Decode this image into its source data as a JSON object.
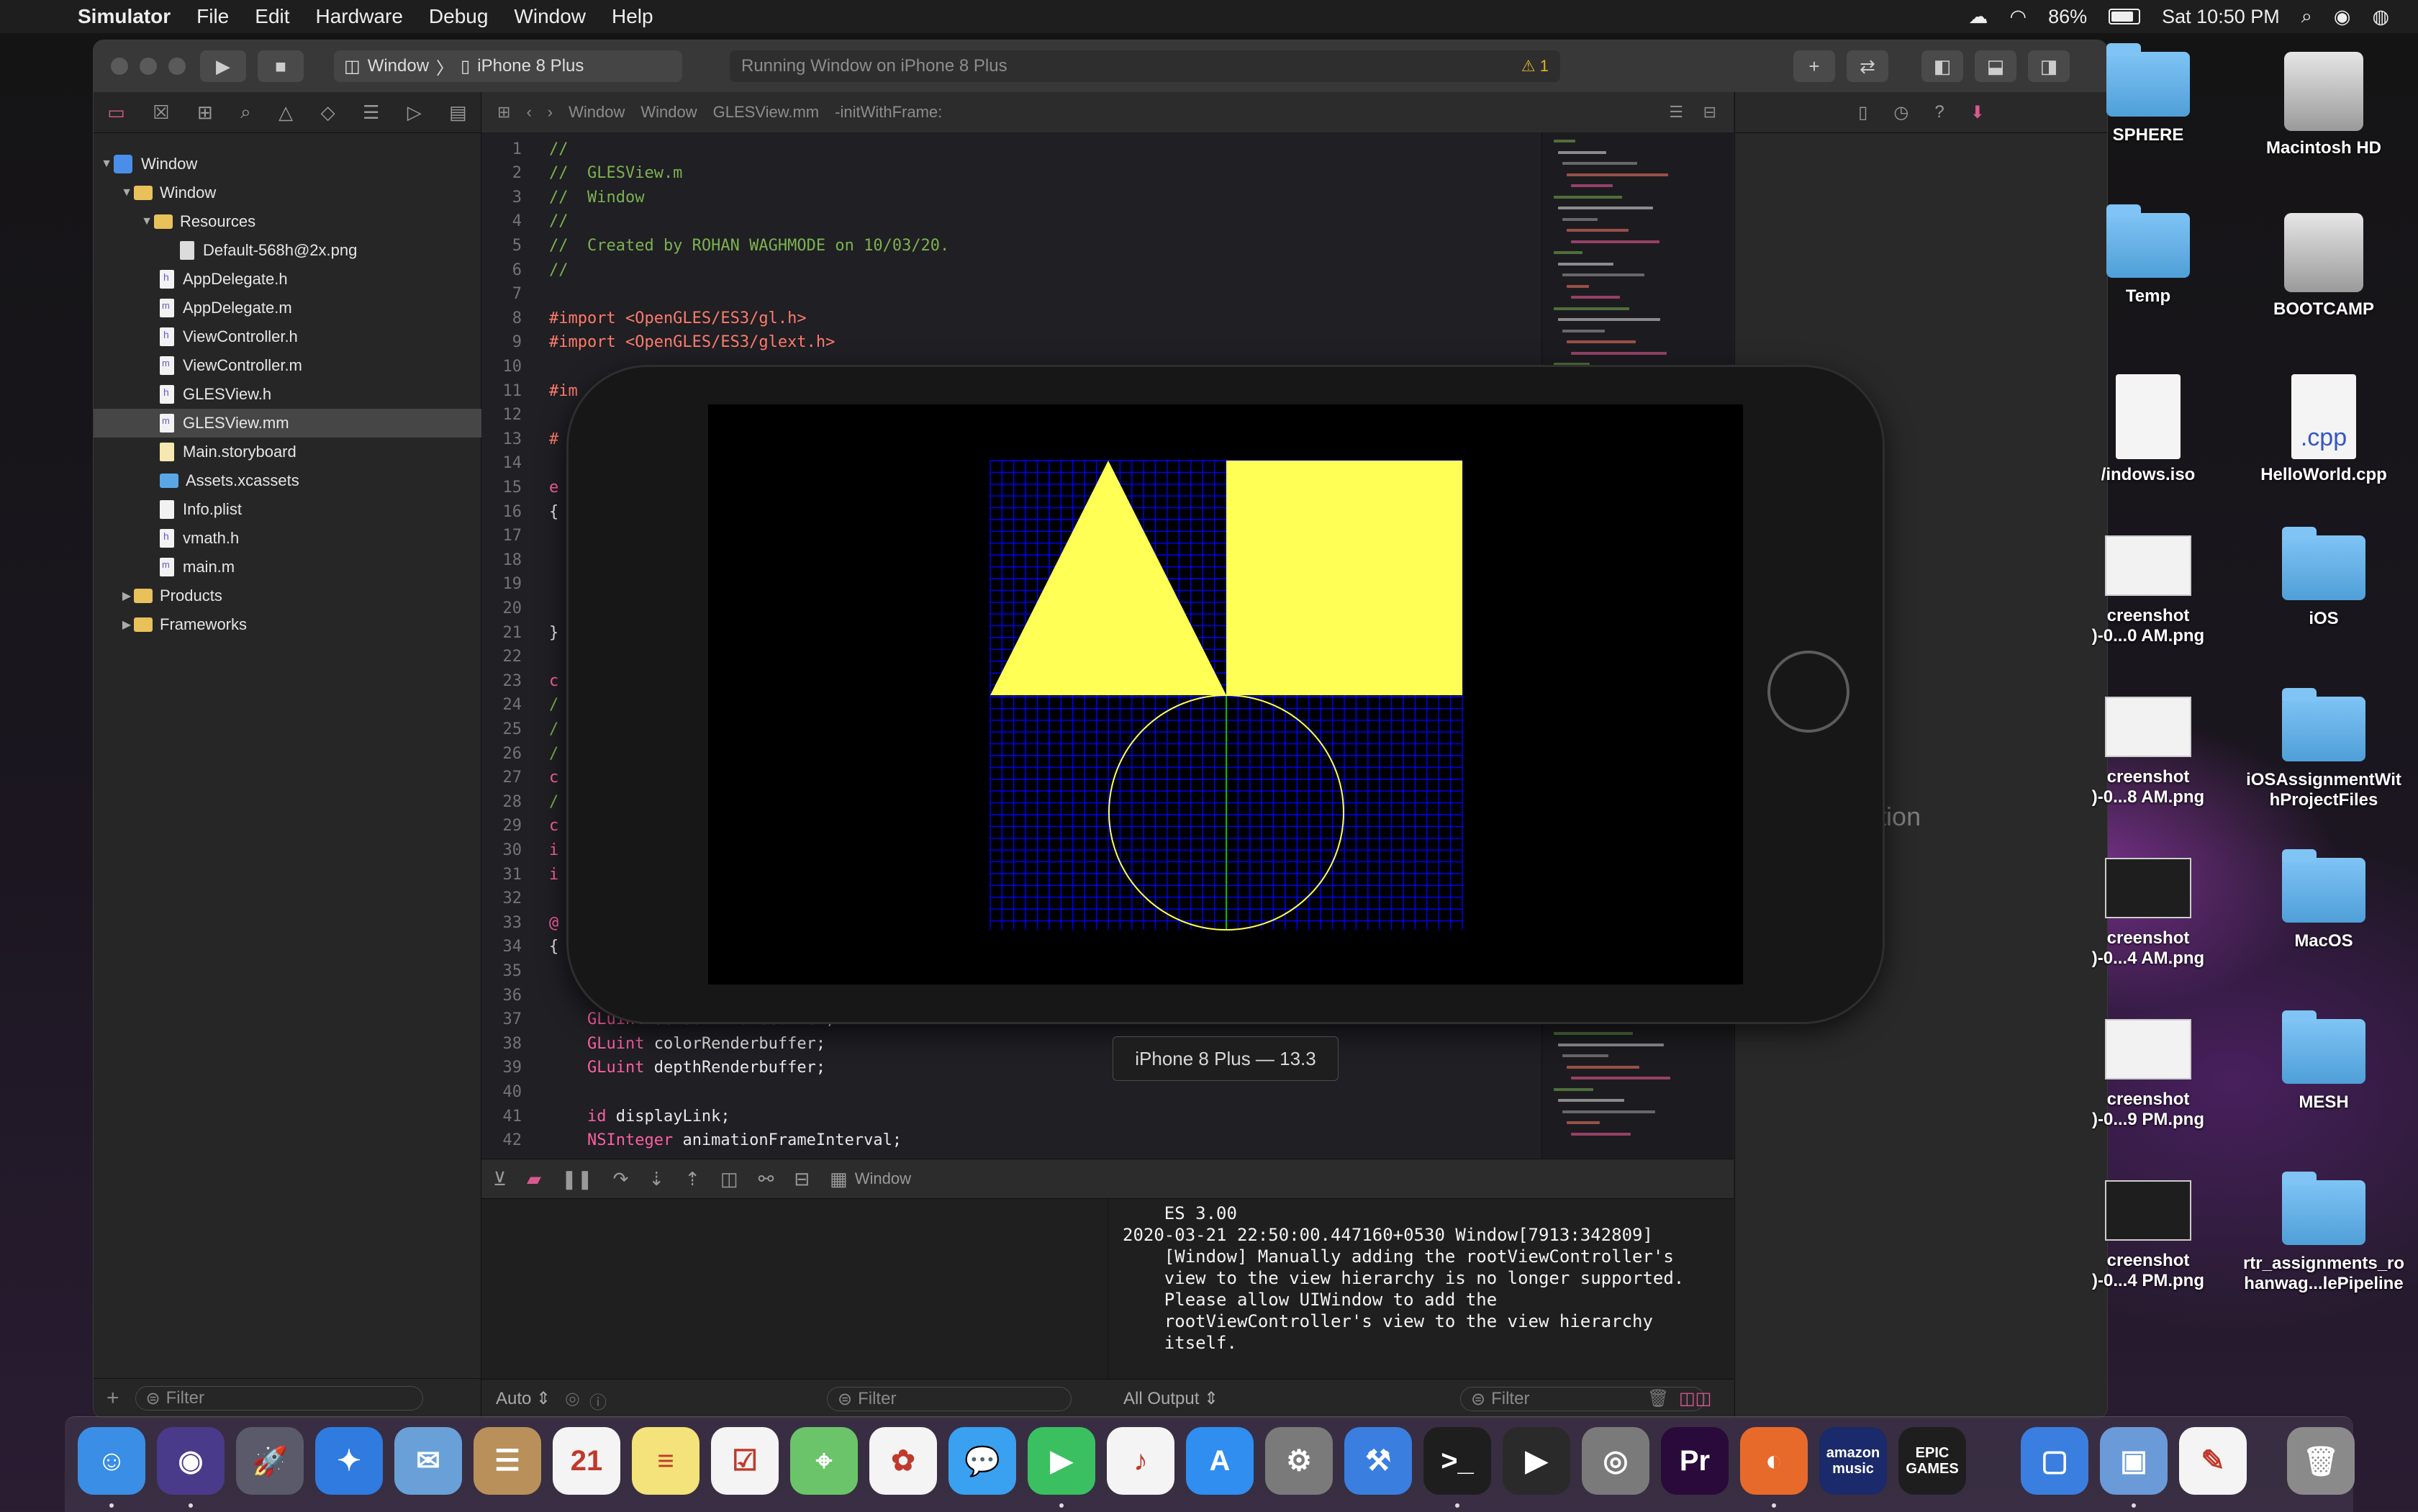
{
  "menubar": {
    "app_name": "Simulator",
    "items": [
      "File",
      "Edit",
      "Hardware",
      "Debug",
      "Window",
      "Help"
    ],
    "battery": "86%",
    "clock": "Sat 10:50 PM"
  },
  "toolbar": {
    "scheme_target": "Window",
    "scheme_device": "iPhone 8 Plus",
    "activity_text": "Running Window on iPhone 8 Plus",
    "warning_count": "1"
  },
  "navigator": {
    "items": [
      {
        "label": "Window"
      },
      {
        "label": "Window"
      },
      {
        "label": "Resources"
      },
      {
        "label": "Default-568h@2x.png"
      },
      {
        "label": "AppDelegate.h"
      },
      {
        "label": "AppDelegate.m"
      },
      {
        "label": "ViewController.h"
      },
      {
        "label": "ViewController.m"
      },
      {
        "label": "GLESView.h"
      },
      {
        "label": "GLESView.mm"
      },
      {
        "label": "Main.storyboard"
      },
      {
        "label": "Assets.xcassets"
      },
      {
        "label": "Info.plist"
      },
      {
        "label": "vmath.h"
      },
      {
        "label": "main.m"
      },
      {
        "label": "Products"
      },
      {
        "label": "Frameworks"
      }
    ],
    "filter_placeholder": "Filter"
  },
  "jumpbar": {
    "crumbs": [
      "Window",
      "Window",
      "GLESView.mm",
      "-initWithFrame:"
    ]
  },
  "editor": {
    "lines": [
      {
        "n": "1",
        "t": "//"
      },
      {
        "n": "2",
        "t": "//  GLESView.m"
      },
      {
        "n": "3",
        "t": "//  Window"
      },
      {
        "n": "4",
        "t": "//"
      },
      {
        "n": "5",
        "t": "//  Created by ROHAN WAGHMODE on 10/03/20."
      },
      {
        "n": "6",
        "t": "//"
      },
      {
        "n": "7",
        "t": ""
      },
      {
        "n": "8",
        "t": "#import <OpenGLES/ES3/gl.h>"
      },
      {
        "n": "9",
        "t": "#import <OpenGLES/ES3/glext.h>"
      },
      {
        "n": "10",
        "t": ""
      },
      {
        "n": "11",
        "t": "#im"
      },
      {
        "n": "12",
        "t": ""
      },
      {
        "n": "13",
        "t": "#"
      },
      {
        "n": "14",
        "t": ""
      },
      {
        "n": "15",
        "t": "e"
      },
      {
        "n": "16",
        "t": "{"
      },
      {
        "n": "17",
        "t": ""
      },
      {
        "n": "18",
        "t": ""
      },
      {
        "n": "19",
        "t": ""
      },
      {
        "n": "20",
        "t": ""
      },
      {
        "n": "21",
        "t": "}"
      },
      {
        "n": "22",
        "t": ""
      },
      {
        "n": "23",
        "t": "c"
      },
      {
        "n": "24",
        "t": "/"
      },
      {
        "n": "25",
        "t": "/"
      },
      {
        "n": "26",
        "t": "/"
      },
      {
        "n": "27",
        "t": "c"
      },
      {
        "n": "28",
        "t": "/"
      },
      {
        "n": "29",
        "t": "c"
      },
      {
        "n": "30",
        "t": "i"
      },
      {
        "n": "31",
        "t": "i"
      },
      {
        "n": "32",
        "t": ""
      },
      {
        "n": "33",
        "t": "@"
      },
      {
        "n": "34",
        "t": "{"
      },
      {
        "n": "35",
        "t": ""
      },
      {
        "n": "36",
        "t": ""
      },
      {
        "n": "37",
        "t": "    GLuint defaultFramebuffer;"
      },
      {
        "n": "38",
        "t": "    GLuint colorRenderbuffer;"
      },
      {
        "n": "39",
        "t": "    GLuint depthRenderbuffer;"
      },
      {
        "n": "40",
        "t": ""
      },
      {
        "n": "41",
        "t": "    id displayLink;"
      },
      {
        "n": "42",
        "t": "    NSInteger animationFrameInterval;"
      }
    ]
  },
  "inspector": {
    "no_selection": "Selection"
  },
  "debug": {
    "process_label": "Window",
    "auto_label": "Auto",
    "output_label": "All Output",
    "filter_placeholder": "Filter",
    "console_lines": [
      "ES 3.00",
      "2020-03-21 22:50:00.447160+0530 Window[7913:342809]",
      "    [Window] Manually adding the rootViewController's",
      "    view to the view hierarchy is no longer supported.",
      "    Please allow UIWindow to add the",
      "    rootViewController's view to the view hierarchy",
      "    itself."
    ]
  },
  "simulator": {
    "device_label": "iPhone 8 Plus — 13.3",
    "colors": {
      "grid": "#0000ff",
      "fill": "#ffff55",
      "circle": "#ffff55",
      "axis": "#00c000"
    }
  },
  "desktop": {
    "icons": [
      {
        "label": "SPHERE",
        "kind": "folder"
      },
      {
        "label": "Macintosh HD",
        "kind": "disk"
      },
      {
        "label": "Temp",
        "kind": "folder"
      },
      {
        "label": "BOOTCAMP",
        "kind": "disk"
      },
      {
        "label": "/indows.iso",
        "kind": "doc",
        "badge": ""
      },
      {
        "label": "HelloWorld.cpp",
        "kind": "doc",
        "badge": ".cpp"
      },
      {
        "label": "creenshot\n)-0...0 AM.png",
        "kind": "thumb"
      },
      {
        "label": "iOS",
        "kind": "folder"
      },
      {
        "label": "creenshot\n)-0...8 AM.png",
        "kind": "thumb"
      },
      {
        "label": "iOSAssignmentWit\nhProjectFiles",
        "kind": "folder"
      },
      {
        "label": "creenshot\n)-0...4 AM.png",
        "kind": "thumb-dark"
      },
      {
        "label": "MacOS",
        "kind": "folder"
      },
      {
        "label": "creenshot\n)-0...9 PM.png",
        "kind": "thumb"
      },
      {
        "label": "MESH",
        "kind": "folder"
      },
      {
        "label": "creenshot\n)-0...4 PM.png",
        "kind": "thumb-dark"
      },
      {
        "label": "rtr_assignments_ro\nhanwag...lePipeline",
        "kind": "folder"
      }
    ]
  },
  "dock": {
    "apps": [
      {
        "name": "finder-icon",
        "glyph": "☺",
        "color": "#3a8ee6"
      },
      {
        "name": "siri-icon",
        "glyph": "◉",
        "color": "#4a3a8a"
      },
      {
        "name": "launchpad-icon",
        "glyph": "🚀",
        "color": "#5a5a6a"
      },
      {
        "name": "safari-icon",
        "glyph": "✦",
        "color": "#2f7be0"
      },
      {
        "name": "mail-icon",
        "glyph": "✉",
        "color": "#6aa0d8"
      },
      {
        "name": "contacts-icon",
        "glyph": "☰",
        "color": "#b9905a"
      },
      {
        "name": "calendar-icon",
        "glyph": "21",
        "color": "#f4f4f4"
      },
      {
        "name": "notes-icon",
        "glyph": "≡",
        "color": "#f4e27a"
      },
      {
        "name": "reminders-icon",
        "glyph": "☑",
        "color": "#f4f4f4"
      },
      {
        "name": "maps-icon",
        "glyph": "⌖",
        "color": "#6cc46a"
      },
      {
        "name": "photos-icon",
        "glyph": "✿",
        "color": "#f4f4f4"
      },
      {
        "name": "messages-icon",
        "glyph": "💬",
        "color": "#3aa0f0"
      },
      {
        "name": "facetime-icon",
        "glyph": "▶",
        "color": "#3ac060"
      },
      {
        "name": "music-icon",
        "glyph": "♪",
        "color": "#f4f4f4"
      },
      {
        "name": "appstore-icon",
        "glyph": "A",
        "color": "#2f8ef0"
      },
      {
        "name": "system-preferences-icon",
        "glyph": "⚙",
        "color": "#7a7a7a"
      },
      {
        "name": "xcode-icon",
        "glyph": "⚒",
        "color": "#3a7ee0"
      },
      {
        "name": "terminal-icon",
        "glyph": ">_",
        "color": "#1e1e1e"
      },
      {
        "name": "final-cut-icon",
        "glyph": "▶",
        "color": "#2a2a2a"
      },
      {
        "name": "compressor-icon",
        "glyph": "◎",
        "color": "#7a7a7a"
      },
      {
        "name": "premiere-icon",
        "glyph": "Pr",
        "color": "#2a0a3a"
      },
      {
        "name": "firefox-icon",
        "glyph": "◐",
        "color": "#e86a2a"
      },
      {
        "name": "amazon-music-icon",
        "glyph": "amazon music",
        "color": "#1a2a6a"
      },
      {
        "name": "epic-games-icon",
        "glyph": "EPIC GAMES",
        "color": "#1e1e1e"
      },
      {
        "name": "simulator-icon",
        "glyph": "▢",
        "color": "#3a7ee0"
      },
      {
        "name": "preview-icon",
        "glyph": "▣",
        "color": "#6a9ad8"
      },
      {
        "name": "textedit-icon",
        "glyph": "✎",
        "color": "#f4f4f4"
      },
      {
        "name": "trash-icon",
        "glyph": "🗑",
        "color": "#8a8a8a"
      }
    ]
  }
}
